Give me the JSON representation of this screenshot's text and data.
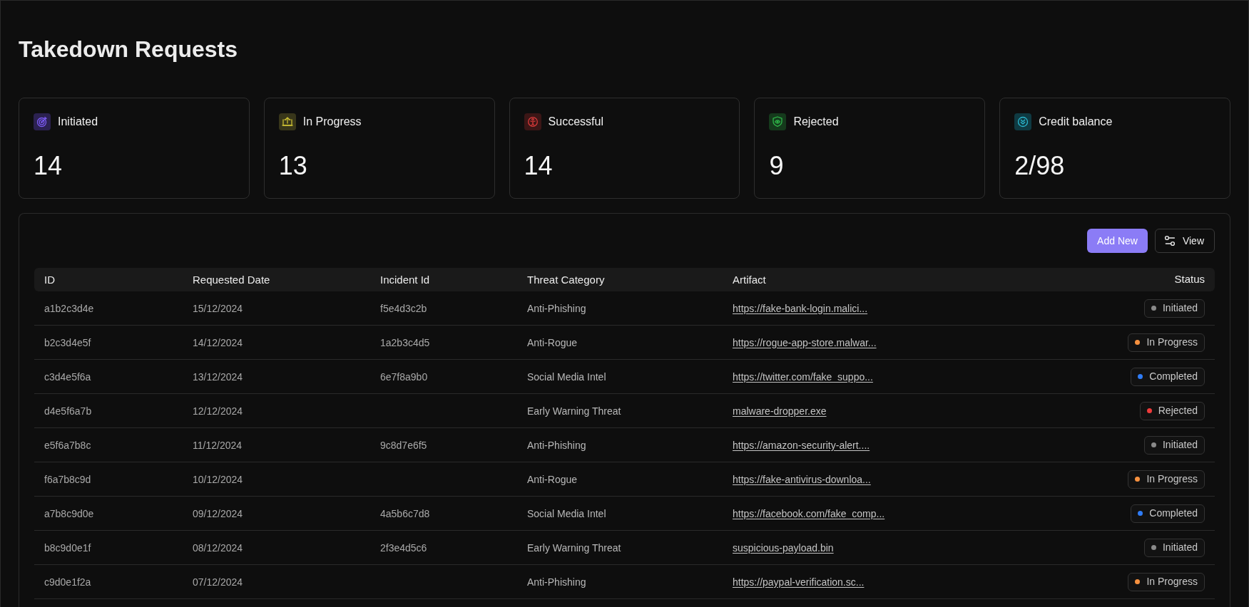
{
  "page": {
    "title": "Takedown Requests"
  },
  "stats": [
    {
      "kind": "initiated",
      "label": "Initiated",
      "value": "14"
    },
    {
      "kind": "in_progress",
      "label": "In Progress",
      "value": "13"
    },
    {
      "kind": "successful",
      "label": "Successful",
      "value": "14"
    },
    {
      "kind": "rejected",
      "label": "Rejected",
      "value": "9"
    },
    {
      "kind": "credit",
      "label": "Credit balance",
      "value": "2/98"
    }
  ],
  "toolbar": {
    "buttons": [
      {
        "kind": "primary",
        "label": "Add New"
      },
      {
        "kind": "view",
        "label": "View"
      }
    ]
  },
  "table": {
    "columns": [
      "ID",
      "Requested Date",
      "Incident Id",
      "Threat Category",
      "Artifact",
      "Status"
    ],
    "rows": [
      {
        "id": "a1b2c3d4e",
        "requested_date": "15/12/2024",
        "incident_id": "f5e4d3c2b",
        "threat_category": "Anti-Phishing",
        "artifact": "https://fake-bank-login.malici...",
        "status": {
          "label": "Initiated",
          "color": "#8a8a8a"
        }
      },
      {
        "id": "b2c3d4e5f",
        "requested_date": "14/12/2024",
        "incident_id": "1a2b3c4d5",
        "threat_category": "Anti-Rogue",
        "artifact": "https://rogue-app-store.malwar...",
        "status": {
          "label": "In Progress",
          "color": "#f7913f"
        }
      },
      {
        "id": "c3d4e5f6a",
        "requested_date": "13/12/2024",
        "incident_id": "6e7f8a9b0",
        "threat_category": "Social Media Intel",
        "artifact": "https://twitter.com/fake_suppo...",
        "status": {
          "label": "Completed",
          "color": "#2f7cf6"
        }
      },
      {
        "id": "d4e5f6a7b",
        "requested_date": "12/12/2024",
        "threat_category": "Early Warning Threat",
        "artifact": "malware-dropper.exe",
        "status": {
          "label": "Rejected",
          "color": "#ef3b3b"
        }
      },
      {
        "id": "e5f6a7b8c",
        "requested_date": "11/12/2024",
        "incident_id": "9c8d7e6f5",
        "threat_category": "Anti-Phishing",
        "artifact": "https://amazon-security-alert....",
        "status": {
          "label": "Initiated",
          "color": "#8a8a8a"
        }
      },
      {
        "id": "f6a7b8c9d",
        "requested_date": "10/12/2024",
        "threat_category": "Anti-Rogue",
        "artifact": "https://fake-antivirus-downloa...",
        "status": {
          "label": "In Progress",
          "color": "#f7913f"
        }
      },
      {
        "id": "a7b8c9d0e",
        "requested_date": "09/12/2024",
        "incident_id": "4a5b6c7d8",
        "threat_category": "Social Media Intel",
        "artifact": "https://facebook.com/fake_comp...",
        "status": {
          "label": "Completed",
          "color": "#2f7cf6"
        }
      },
      {
        "id": "b8c9d0e1f",
        "requested_date": "08/12/2024",
        "incident_id": "2f3e4d5c6",
        "threat_category": "Early Warning Threat",
        "artifact": "suspicious-payload.bin",
        "status": {
          "label": "Initiated",
          "color": "#8a8a8a"
        }
      },
      {
        "id": "c9d0e1f2a",
        "requested_date": "07/12/2024",
        "threat_category": "Anti-Phishing",
        "artifact": "https://paypal-verification.sc...",
        "status": {
          "label": "In Progress",
          "color": "#f7913f"
        }
      }
    ]
  }
}
